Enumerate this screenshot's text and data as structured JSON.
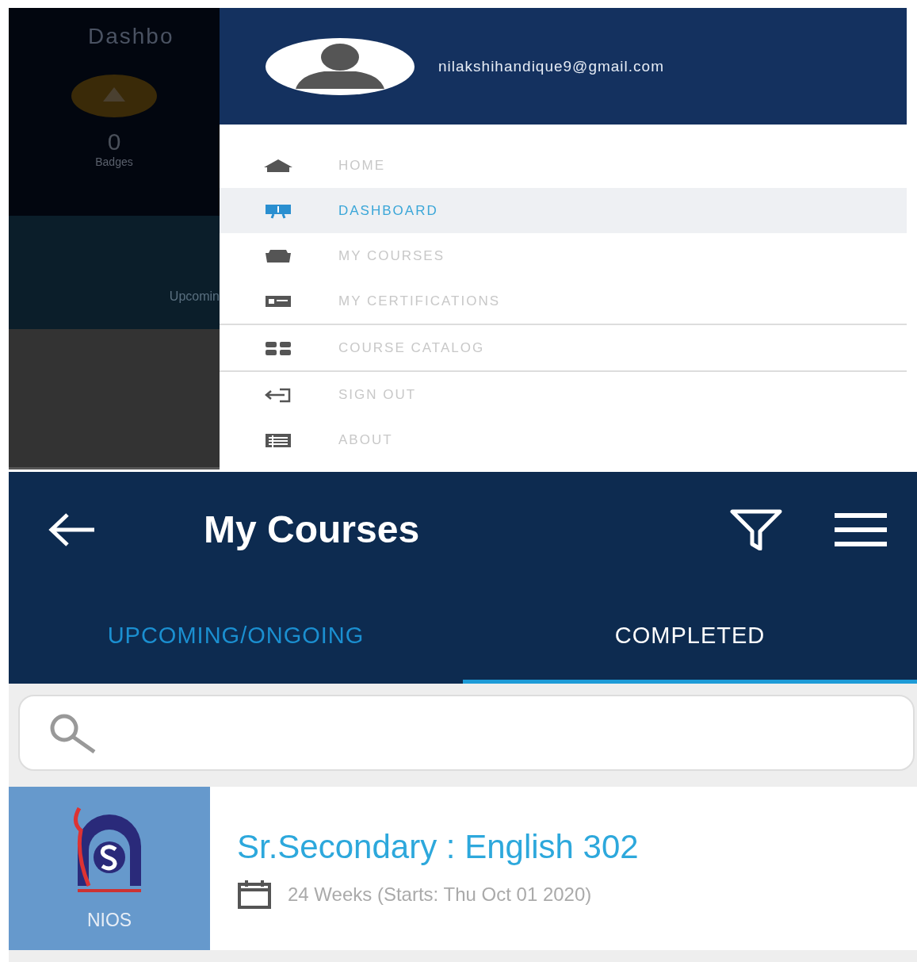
{
  "drawer_screen": {
    "background": {
      "title": "Dashbo",
      "badge_count": "0",
      "badge_label": "Badges",
      "section_label": "Upcomin"
    },
    "drawer": {
      "email": "nilakshihandique9@gmail.com",
      "menu_groups": [
        {
          "items": [
            {
              "label": "HOME",
              "selected": false
            },
            {
              "label": "DASHBOARD",
              "selected": true
            },
            {
              "label": "MY COURSES",
              "selected": false
            },
            {
              "label": "MY CERTIFICATIONS",
              "selected": false
            }
          ]
        },
        {
          "items": [
            {
              "label": "COURSE CATALOG",
              "selected": false
            }
          ]
        },
        {
          "items": [
            {
              "label": "SIGN OUT",
              "selected": false
            },
            {
              "label": "ABOUT",
              "selected": false
            }
          ]
        }
      ]
    }
  },
  "courses_screen": {
    "title": "My Courses",
    "tabs": [
      {
        "label": "UPCOMING/ONGOING",
        "selected": false
      },
      {
        "label": "COMPLETED",
        "selected": true
      }
    ],
    "courses": [
      {
        "logo_label": "NIOS",
        "title": "Sr.Secondary : English 302",
        "duration": "24 Weeks (Starts: Thu Oct 01 2020)"
      }
    ]
  }
}
